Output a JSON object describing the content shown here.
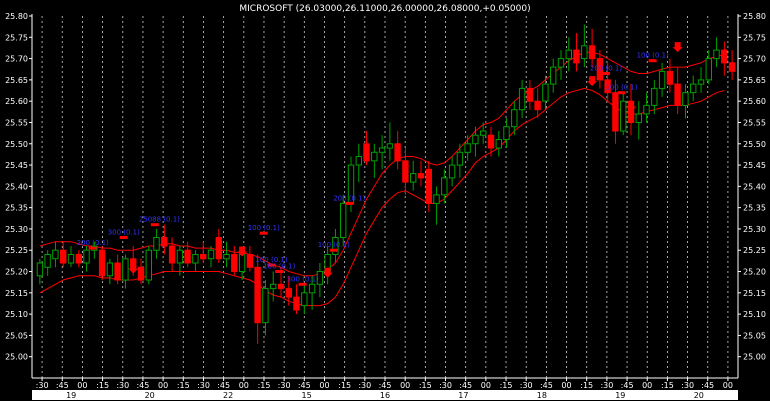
{
  "chart_data": {
    "type": "candlestick",
    "title": "MICROSOFT (26.03000,26.11000,26.00000,26.08000,+0.05000)",
    "ylim": [
      24.95,
      25.8
    ],
    "yticks": [
      "25.80",
      "25.75",
      "25.70",
      "25.65",
      "25.60",
      "25.55",
      "25.50",
      "25.45",
      "25.40",
      "25.35",
      "25.30",
      "25.25",
      "25.20",
      "25.15",
      "25.10",
      "25.05",
      "25.00"
    ],
    "time_ticks": [
      ":30",
      ":45",
      "00",
      ":15",
      ":30",
      ":45",
      "00",
      ":15",
      ":30",
      ":45",
      "00",
      ":15",
      ":30",
      ":45",
      "00",
      ":15",
      ":30",
      ":45",
      "00",
      ":15",
      ":30",
      ":45",
      "00",
      ":15",
      ":30",
      ":45",
      "00",
      ":15",
      ":30",
      ":45",
      "00",
      ":15",
      ":30",
      ":45",
      "00"
    ],
    "date_ticks": [
      "19",
      "20",
      "22",
      "15",
      "16",
      "17",
      "18",
      "19",
      "20"
    ],
    "grid": true,
    "colors": {
      "background": "#000000",
      "up": "#00a000",
      "down": "#ff0000",
      "band": "#ff0000",
      "annotation": "#3333ff",
      "axis_bar": "#ffffff"
    },
    "candles": [
      {
        "o": 25.19,
        "h": 25.23,
        "l": 25.17,
        "c": 25.22
      },
      {
        "o": 25.21,
        "h": 25.25,
        "l": 25.19,
        "c": 25.24
      },
      {
        "o": 25.23,
        "h": 25.27,
        "l": 25.21,
        "c": 25.25
      },
      {
        "o": 25.25,
        "h": 25.27,
        "l": 25.21,
        "c": 25.22
      },
      {
        "o": 25.22,
        "h": 25.26,
        "l": 25.21,
        "c": 25.24
      },
      {
        "o": 25.24,
        "h": 25.25,
        "l": 25.21,
        "c": 25.22
      },
      {
        "o": 25.22,
        "h": 25.26,
        "l": 25.2,
        "c": 25.25
      },
      {
        "o": 25.25,
        "h": 25.27,
        "l": 25.23,
        "c": 25.26
      },
      {
        "o": 25.25,
        "h": 25.26,
        "l": 25.18,
        "c": 25.19
      },
      {
        "o": 25.19,
        "h": 25.23,
        "l": 25.17,
        "c": 25.22
      },
      {
        "o": 25.22,
        "h": 25.24,
        "l": 25.17,
        "c": 25.18
      },
      {
        "o": 25.18,
        "h": 25.24,
        "l": 25.16,
        "c": 25.23
      },
      {
        "o": 25.23,
        "h": 25.26,
        "l": 25.19,
        "c": 25.21
      },
      {
        "o": 25.21,
        "h": 25.23,
        "l": 25.17,
        "c": 25.18
      },
      {
        "o": 25.18,
        "h": 25.26,
        "l": 25.17,
        "c": 25.25
      },
      {
        "o": 25.25,
        "h": 25.3,
        "l": 25.23,
        "c": 25.28
      },
      {
        "o": 25.28,
        "h": 25.31,
        "l": 25.24,
        "c": 25.26
      },
      {
        "o": 25.26,
        "h": 25.28,
        "l": 25.2,
        "c": 25.22
      },
      {
        "o": 25.22,
        "h": 25.26,
        "l": 25.19,
        "c": 25.25
      },
      {
        "o": 25.25,
        "h": 25.27,
        "l": 25.21,
        "c": 25.22
      },
      {
        "o": 25.22,
        "h": 25.25,
        "l": 25.2,
        "c": 25.24
      },
      {
        "o": 25.24,
        "h": 25.27,
        "l": 25.22,
        "c": 25.23
      },
      {
        "o": 25.23,
        "h": 25.26,
        "l": 25.21,
        "c": 25.25
      },
      {
        "o": 25.28,
        "h": 25.3,
        "l": 25.22,
        "c": 25.23
      },
      {
        "o": 25.23,
        "h": 25.27,
        "l": 25.21,
        "c": 25.24
      },
      {
        "o": 25.24,
        "h": 25.26,
        "l": 25.19,
        "c": 25.2
      },
      {
        "o": 25.2,
        "h": 25.25,
        "l": 25.18,
        "c": 25.24
      },
      {
        "o": 25.24,
        "h": 25.26,
        "l": 25.2,
        "c": 25.21
      },
      {
        "o": 25.21,
        "h": 25.24,
        "l": 25.03,
        "c": 25.08
      },
      {
        "o": 25.08,
        "h": 25.18,
        "l": 25.05,
        "c": 25.16
      },
      {
        "o": 25.16,
        "h": 25.2,
        "l": 25.13,
        "c": 25.17
      },
      {
        "o": 25.17,
        "h": 25.21,
        "l": 25.14,
        "c": 25.16
      },
      {
        "o": 25.16,
        "h": 25.19,
        "l": 25.12,
        "c": 25.14
      },
      {
        "o": 25.14,
        "h": 25.17,
        "l": 25.1,
        "c": 25.11
      },
      {
        "o": 25.12,
        "h": 25.17,
        "l": 25.1,
        "c": 25.15
      },
      {
        "o": 25.15,
        "h": 25.19,
        "l": 25.11,
        "c": 25.17
      },
      {
        "o": 25.17,
        "h": 25.22,
        "l": 25.14,
        "c": 25.2
      },
      {
        "o": 25.2,
        "h": 25.26,
        "l": 25.17,
        "c": 25.24
      },
      {
        "o": 25.24,
        "h": 25.3,
        "l": 25.22,
        "c": 25.28
      },
      {
        "o": 25.28,
        "h": 25.38,
        "l": 25.26,
        "c": 25.36
      },
      {
        "o": 25.36,
        "h": 25.47,
        "l": 25.34,
        "c": 25.45
      },
      {
        "o": 25.45,
        "h": 25.5,
        "l": 25.41,
        "c": 25.47
      },
      {
        "o": 25.5,
        "h": 25.53,
        "l": 25.45,
        "c": 25.46
      },
      {
        "o": 25.46,
        "h": 25.5,
        "l": 25.42,
        "c": 25.48
      },
      {
        "o": 25.48,
        "h": 25.52,
        "l": 25.44,
        "c": 25.49
      },
      {
        "o": 25.49,
        "h": 25.55,
        "l": 25.46,
        "c": 25.5
      },
      {
        "o": 25.5,
        "h": 25.53,
        "l": 25.44,
        "c": 25.46
      },
      {
        "o": 25.46,
        "h": 25.49,
        "l": 25.38,
        "c": 25.41
      },
      {
        "o": 25.41,
        "h": 25.46,
        "l": 25.39,
        "c": 25.43
      },
      {
        "o": 25.43,
        "h": 25.46,
        "l": 25.4,
        "c": 25.42
      },
      {
        "o": 25.44,
        "h": 25.46,
        "l": 25.34,
        "c": 25.36
      },
      {
        "o": 25.36,
        "h": 25.4,
        "l": 25.31,
        "c": 25.38
      },
      {
        "o": 25.38,
        "h": 25.44,
        "l": 25.36,
        "c": 25.42
      },
      {
        "o": 25.42,
        "h": 25.47,
        "l": 25.4,
        "c": 25.45
      },
      {
        "o": 25.45,
        "h": 25.5,
        "l": 25.42,
        "c": 25.48
      },
      {
        "o": 25.48,
        "h": 25.52,
        "l": 25.46,
        "c": 25.5
      },
      {
        "o": 25.5,
        "h": 25.54,
        "l": 25.47,
        "c": 25.52
      },
      {
        "o": 25.52,
        "h": 25.55,
        "l": 25.5,
        "c": 25.53
      },
      {
        "o": 25.52,
        "h": 25.54,
        "l": 25.47,
        "c": 25.49
      },
      {
        "o": 25.49,
        "h": 25.53,
        "l": 25.47,
        "c": 25.51
      },
      {
        "o": 25.51,
        "h": 25.56,
        "l": 25.49,
        "c": 25.54
      },
      {
        "o": 25.54,
        "h": 25.6,
        "l": 25.52,
        "c": 25.58
      },
      {
        "o": 25.58,
        "h": 25.65,
        "l": 25.56,
        "c": 25.63
      },
      {
        "o": 25.63,
        "h": 25.65,
        "l": 25.58,
        "c": 25.6
      },
      {
        "o": 25.6,
        "h": 25.63,
        "l": 25.56,
        "c": 25.58
      },
      {
        "o": 25.6,
        "h": 25.66,
        "l": 25.58,
        "c": 25.64
      },
      {
        "o": 25.64,
        "h": 25.7,
        "l": 25.62,
        "c": 25.68
      },
      {
        "o": 25.68,
        "h": 25.72,
        "l": 25.65,
        "c": 25.7
      },
      {
        "o": 25.7,
        "h": 25.75,
        "l": 25.67,
        "c": 25.72
      },
      {
        "o": 25.72,
        "h": 25.76,
        "l": 25.67,
        "c": 25.69
      },
      {
        "o": 25.7,
        "h": 25.78,
        "l": 25.68,
        "c": 25.73
      },
      {
        "o": 25.73,
        "h": 25.77,
        "l": 25.68,
        "c": 25.7
      },
      {
        "o": 25.7,
        "h": 25.72,
        "l": 25.63,
        "c": 25.65
      },
      {
        "o": 25.65,
        "h": 25.69,
        "l": 25.6,
        "c": 25.62
      },
      {
        "o": 25.62,
        "h": 25.65,
        "l": 25.5,
        "c": 25.53
      },
      {
        "o": 25.53,
        "h": 25.62,
        "l": 25.52,
        "c": 25.6
      },
      {
        "o": 25.6,
        "h": 25.64,
        "l": 25.52,
        "c": 25.55
      },
      {
        "o": 25.55,
        "h": 25.6,
        "l": 25.51,
        "c": 25.57
      },
      {
        "o": 25.57,
        "h": 25.62,
        "l": 25.55,
        "c": 25.59
      },
      {
        "o": 25.59,
        "h": 25.65,
        "l": 25.57,
        "c": 25.63
      },
      {
        "o": 25.63,
        "h": 25.69,
        "l": 25.61,
        "c": 25.67
      },
      {
        "o": 25.67,
        "h": 25.7,
        "l": 25.62,
        "c": 25.64
      },
      {
        "o": 25.64,
        "h": 25.68,
        "l": 25.57,
        "c": 25.59
      },
      {
        "o": 25.59,
        "h": 25.64,
        "l": 25.56,
        "c": 25.62
      },
      {
        "o": 25.62,
        "h": 25.66,
        "l": 25.6,
        "c": 25.64
      },
      {
        "o": 25.64,
        "h": 25.68,
        "l": 25.62,
        "c": 25.65
      },
      {
        "o": 25.65,
        "h": 25.72,
        "l": 25.64,
        "c": 25.7
      },
      {
        "o": 25.7,
        "h": 25.75,
        "l": 25.68,
        "c": 25.72
      },
      {
        "o": 25.72,
        "h": 25.74,
        "l": 25.66,
        "c": 25.69
      },
      {
        "o": 25.69,
        "h": 25.72,
        "l": 25.65,
        "c": 25.67
      }
    ],
    "upper_band": [
      25.26,
      25.265,
      25.27,
      25.27,
      25.27,
      25.265,
      25.26,
      25.26,
      25.255,
      25.255,
      25.25,
      25.25,
      25.25,
      25.255,
      25.26,
      25.26,
      25.265,
      25.265,
      25.26,
      25.26,
      25.255,
      25.255,
      25.255,
      25.25,
      25.25,
      25.245,
      25.245,
      25.24,
      25.235,
      25.225,
      25.215,
      25.21,
      25.2,
      25.195,
      25.19,
      25.19,
      25.195,
      25.205,
      25.22,
      25.25,
      25.29,
      25.33,
      25.37,
      25.4,
      25.43,
      25.45,
      25.465,
      25.47,
      25.47,
      25.465,
      25.455,
      25.45,
      25.455,
      25.47,
      25.49,
      25.51,
      25.53,
      25.545,
      25.55,
      25.56,
      25.58,
      25.6,
      25.615,
      25.625,
      25.635,
      25.65,
      25.665,
      25.68,
      25.695,
      25.705,
      25.715,
      25.715,
      25.71,
      25.7,
      25.69,
      25.68,
      25.67,
      25.665,
      25.665,
      25.67,
      25.675,
      25.68,
      25.68,
      25.68,
      25.685,
      25.69,
      25.7,
      25.705,
      25.71
    ],
    "lower_band": [
      25.15,
      25.16,
      25.17,
      25.18,
      25.185,
      25.19,
      25.19,
      25.19,
      25.185,
      25.185,
      25.18,
      25.18,
      25.18,
      25.185,
      25.19,
      25.195,
      25.2,
      25.2,
      25.2,
      25.2,
      25.2,
      25.2,
      25.2,
      25.2,
      25.195,
      25.19,
      25.185,
      25.18,
      25.17,
      25.155,
      25.145,
      25.14,
      25.13,
      25.125,
      25.12,
      25.12,
      25.12,
      25.125,
      25.14,
      25.17,
      25.21,
      25.25,
      25.29,
      25.32,
      25.35,
      25.37,
      25.385,
      25.39,
      25.38,
      25.37,
      25.36,
      25.36,
      25.37,
      25.39,
      25.41,
      25.43,
      25.455,
      25.47,
      25.48,
      25.49,
      25.51,
      25.53,
      25.545,
      25.555,
      25.565,
      25.58,
      25.595,
      25.61,
      25.62,
      25.625,
      25.63,
      25.625,
      25.615,
      25.6,
      25.585,
      25.575,
      25.57,
      25.57,
      25.575,
      25.58,
      25.585,
      25.59,
      25.59,
      25.59,
      25.595,
      25.6,
      25.61,
      25.62,
      25.625
    ],
    "annotations": [
      {
        "index": 14,
        "price": 25.31,
        "label": "25088 (0.1)"
      },
      {
        "index": 10,
        "price": 25.28,
        "label": "300 (0.1)"
      },
      {
        "index": 6,
        "price": 25.255,
        "label": "200 (0.1)"
      },
      {
        "index": 28,
        "price": 25.29,
        "label": "100 (0.1)"
      },
      {
        "index": 29,
        "price": 25.215,
        "label": "100 (0.1)"
      },
      {
        "index": 30,
        "price": 25.2,
        "label": "100 (0.1)"
      },
      {
        "index": 33,
        "price": 25.17,
        "label": "300 (0.1)"
      },
      {
        "index": 37,
        "price": 25.25,
        "label": "100 (0.1)"
      },
      {
        "index": 39,
        "price": 25.36,
        "label": "200 (0.1)"
      },
      {
        "index": 72,
        "price": 25.665,
        "label": "200 (0.1)"
      },
      {
        "index": 74,
        "price": 25.62,
        "label": "100 (0.1)"
      },
      {
        "index": 78,
        "price": 25.695,
        "label": "100 (0.1)"
      }
    ],
    "arrows_down": [
      {
        "index": 12,
        "price": 25.2
      },
      {
        "index": 26,
        "price": 25.24
      },
      {
        "index": 37,
        "price": 25.19
      },
      {
        "index": 71,
        "price": 25.64
      },
      {
        "index": 76,
        "price": 25.58
      },
      {
        "index": 82,
        "price": 25.72
      }
    ]
  }
}
